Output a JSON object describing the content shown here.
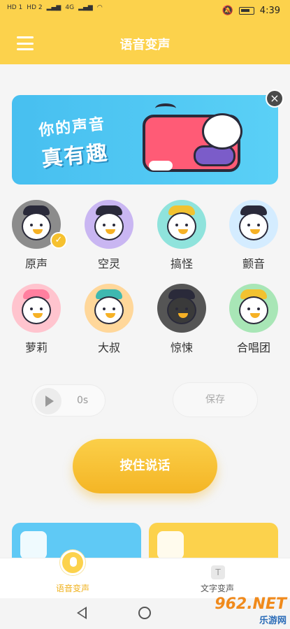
{
  "status_bar": {
    "left_indicators": [
      "HD 1",
      "HD 2",
      "4G",
      "4G"
    ],
    "time": "4:39"
  },
  "app_bar": {
    "title": "语音变声"
  },
  "banner": {
    "line1": "你的声音",
    "line2": "真有趣",
    "close": "×"
  },
  "voices": [
    {
      "label": "原声",
      "bg": "#8c8c8c",
      "selected": true
    },
    {
      "label": "空灵",
      "bg": "#c9b6f2"
    },
    {
      "label": "搞怪",
      "bg": "#8fe3dc"
    },
    {
      "label": "颤音",
      "bg": "#d4ecff"
    },
    {
      "label": "萝莉",
      "bg": "#ffc4ce"
    },
    {
      "label": "大叔",
      "bg": "#ffd79a"
    },
    {
      "label": "惊悚",
      "bg": "#555555"
    },
    {
      "label": "合唱团",
      "bg": "#a8e6b6"
    }
  ],
  "player": {
    "duration": "0s"
  },
  "save": {
    "label": "保存"
  },
  "record": {
    "label": "按住说话"
  },
  "tabs": [
    {
      "label": "语音变声",
      "active": true,
      "color": "#f0b21e"
    },
    {
      "label": "文字变声",
      "active": false,
      "color": "#555555",
      "icon_text": "T"
    }
  ],
  "watermark": {
    "top": "962.NET",
    "bottom": "乐游网"
  }
}
